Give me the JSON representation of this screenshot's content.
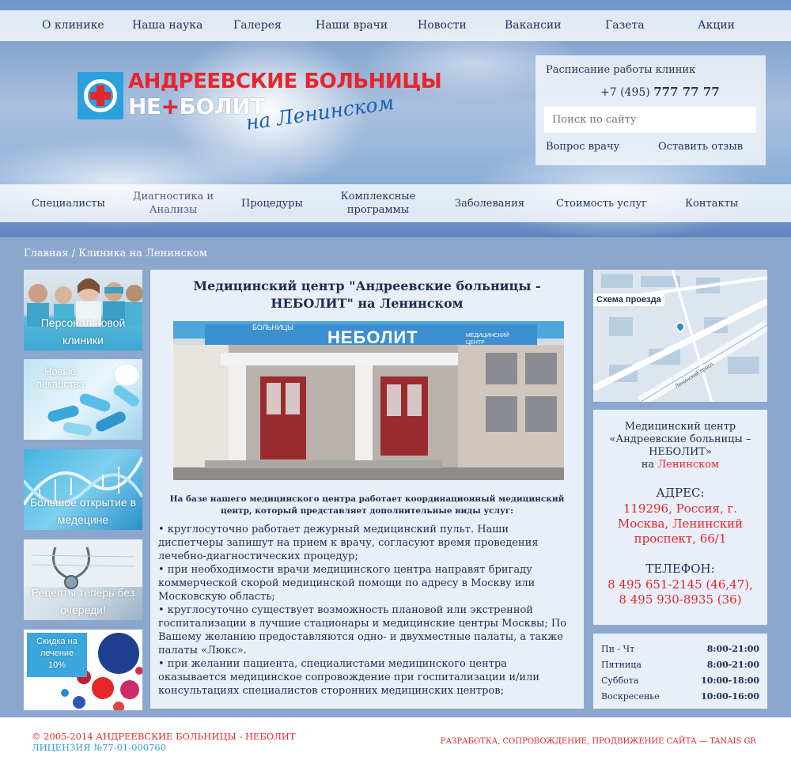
{
  "top_nav": [
    "О клинике",
    "Наша наука",
    "Галерея",
    "Наши врачи",
    "Новости",
    "Вакансии",
    "Газета",
    "Акции"
  ],
  "logo": {
    "line1": "АНДРЕЕВСКИЕ БОЛЬНИЦЫ",
    "line2a": "НЕ",
    "line2b": "+",
    "line2c": "БОЛИТ",
    "line3": "на Ленинском"
  },
  "header_box": {
    "schedule_link": "Расписание работы клиник",
    "phone_prefix": "+7 (495)",
    "phone_number": "777 77 77",
    "search_placeholder": "Поиск по сайту",
    "ask_doctor": "Вопрос врачу",
    "leave_review": "Оставить отзыв"
  },
  "main_nav": [
    {
      "line1": "Специалисты",
      "line2": ""
    },
    {
      "line1": "Диагностика и",
      "line2": "Анализы"
    },
    {
      "line1": "Процедуры",
      "line2": ""
    },
    {
      "line1": "Комплексные",
      "line2": "программы"
    },
    {
      "line1": "Заболевания",
      "line2": ""
    },
    {
      "line1": "Стоимость услуг",
      "line2": ""
    },
    {
      "line1": "Контакты",
      "line2": ""
    }
  ],
  "breadcrumb": "Главная / Клиника на Ленинском",
  "promos": [
    {
      "line1": "Персонал новой",
      "line2": "клиники"
    },
    {
      "line1": "Новые",
      "line2": "лекарства"
    },
    {
      "line1": "Большое открытие в",
      "line2": "медецине"
    },
    {
      "line1": "Рецепты теперь без",
      "line2": "очереди!"
    },
    {
      "line1": "Скидка на",
      "line2": "лечение",
      "line3": "10%"
    }
  ],
  "article": {
    "title_line1": "Медицинский центр \"Андреевские больницы -",
    "title_line2": "НЕБОЛИТ\" на Ленинском",
    "photo_sign": "НЕБОЛИТ",
    "photo_sign_small": "МЕДИЦИНСКИЙ ЦЕНТР",
    "photo_sign_top": "БОЛЬНИЦЫ",
    "intro_line1": "На базе нашего медицинского центра работает координационный медицинский",
    "intro_line2": "центр, который представляет дополнительные виды услуг:",
    "paragraphs": [
      [
        "• круглосуточно работает дежурный медицинский пульт. Наши",
        "диспетчеры запишут на прием к врачу, согласуют время проведения",
        "лечебно-диагностических процедур;"
      ],
      [
        "• при необходимости врачи медицинского центра направят бригаду",
        "коммерческой скорой медицинской помощи по адресу в Москву или",
        "Московскую область;"
      ],
      [
        "• круглосуточно существует возможность плановой или экстренной",
        "госпитализации в лучшие стационары и медицинские центры Москвы; По",
        "Вашему желанию предоставляются одно- и двухместные палаты, а также",
        "палаты «Люкс»."
      ],
      [
        "• при желании пациента, специалистами медицинского центра",
        "оказывается медицинское сопровождение при госпитализации и/или",
        "консультациях специалистов сторонних медицинских центров;"
      ]
    ]
  },
  "map": {
    "label": "Схема проезда",
    "street": "Ленинский просп."
  },
  "address_card": {
    "name_line1": "Медицинский центр",
    "name_line2": "«Андреевские больницы –",
    "name_line3": "НЕБОЛИТ»",
    "name_line4_prefix": "на ",
    "name_line4_red": "Ленинском",
    "address_label": "АДРЕС:",
    "address_lines": [
      "119296, Россия, г.",
      "Москва, Ленинский",
      "проспект, 66/1"
    ],
    "phone_label": "ТЕЛЕФОН:",
    "phones": [
      "8 495 651-2145 (46,47),",
      "8 495 930-8935 (36)"
    ]
  },
  "hours": [
    {
      "day": "Пн - Чт",
      "time": "8:00-21:00"
    },
    {
      "day": "Пятница",
      "time": "8:00-21:00"
    },
    {
      "day": "Суббота",
      "time": "10:00-18:00"
    },
    {
      "day": "Воскресенье",
      "time": "10:00-16:00"
    }
  ],
  "footer": {
    "copyright": "© 2005-2014 АНДРЕЕВСКИЕ БОЛЬНИЦЫ - НЕБОЛИТ",
    "license": "ЛИЦЕНЗИЯ №77-01-000760",
    "developer": "РАЗРАБОТКА, СОПРОВОЖДЕНИЕ, ПРОДВИЖЕНИЕ САЙТА — TANAIS GR"
  },
  "colors": {
    "brand_red": "#e5262b",
    "brand_blue": "#2aa0dc",
    "text_navy": "#1e2d4d",
    "panel": "#e9eff8"
  }
}
